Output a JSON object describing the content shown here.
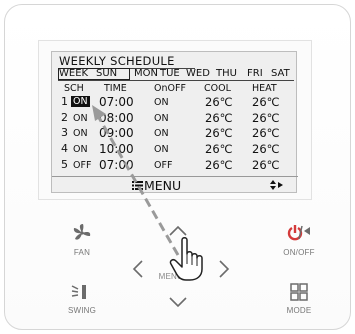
{
  "screen": {
    "title": "WEEKLY SCHEDULE",
    "week_days": [
      "WEEK",
      "SUN",
      "MON",
      "TUE",
      "WED",
      "THU",
      "FRI",
      "SAT"
    ],
    "columns": [
      "SCH",
      "TIME",
      "OnOFF",
      "COOL",
      "HEAT"
    ],
    "rows": [
      {
        "sch": "1",
        "sch_state": "ON",
        "time": "07:00",
        "state": "ON",
        "cool": "26℃",
        "heat": "26℃"
      },
      {
        "sch": "2",
        "sch_state": "ON",
        "time": "08:00",
        "state": "ON",
        "cool": "26℃",
        "heat": "26℃"
      },
      {
        "sch": "3",
        "sch_state": "ON",
        "time": "09:00",
        "state": "ON",
        "cool": "26℃",
        "heat": "26℃"
      },
      {
        "sch": "4",
        "sch_state": "ON",
        "time": "10:00",
        "state": "ON",
        "cool": "26℃",
        "heat": "26℃"
      },
      {
        "sch": "5",
        "sch_state": "OFF",
        "time": "07:00",
        "state": "OFF",
        "cool": "26℃",
        "heat": "26℃"
      }
    ],
    "menu_label": "MENU",
    "menu_icon": "list-icon",
    "nav_icon": "up-down-right-icon"
  },
  "buttons": {
    "fan_label": "FAN",
    "onoff_label": "ON/OFF",
    "swing_label": "SWING",
    "mode_label": "MODE",
    "menu_ok_label": "MENU/OK"
  },
  "colors": {
    "button_gray": "#6b6b6b",
    "onoff_red": "#d43a3a",
    "lcd_bg": "#efefef"
  }
}
